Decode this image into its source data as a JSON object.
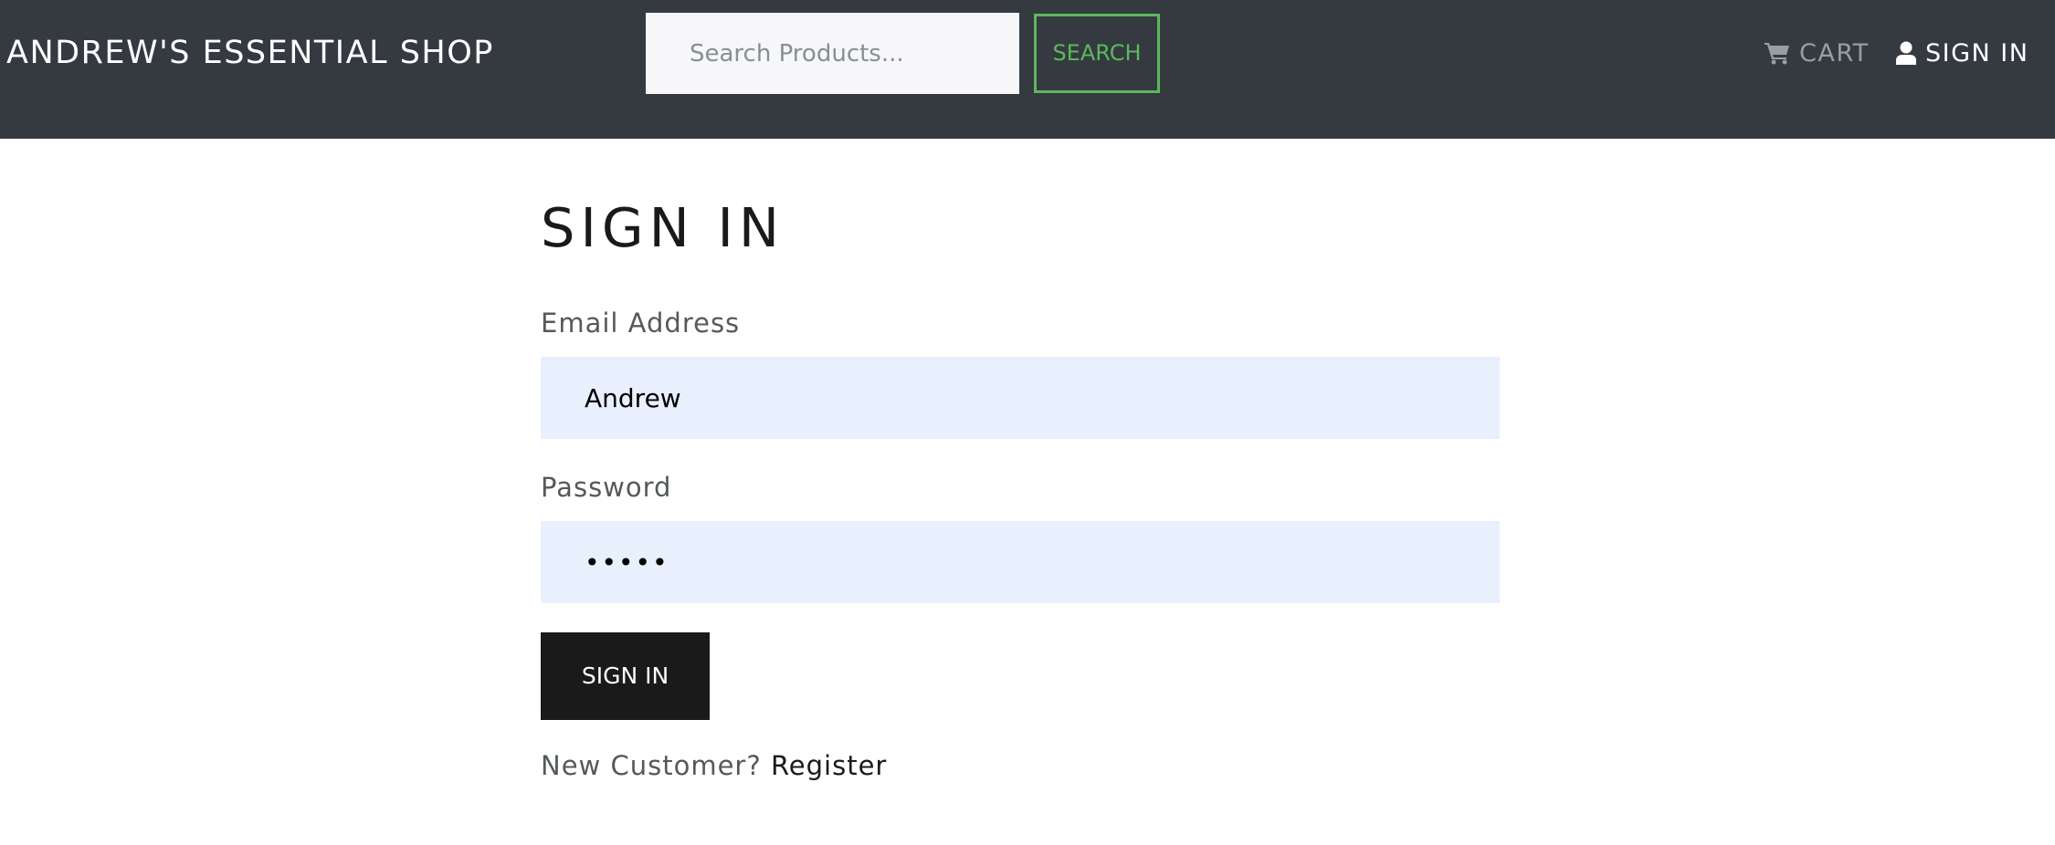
{
  "header": {
    "brand": "ANDREW'S ESSENTIAL SHOP",
    "search": {
      "placeholder": "Search Products...",
      "value": "",
      "button_label": "SEARCH"
    },
    "nav": {
      "cart_label": "CART",
      "cart_icon": "cart-icon",
      "signin_label": "SIGN IN",
      "signin_icon": "user-icon"
    }
  },
  "form": {
    "title": "SIGN IN",
    "email_label": "Email Address",
    "email_value": "Andrew",
    "password_label": "Password",
    "password_value": "•••••",
    "submit_label": "SIGN IN",
    "new_customer_text": "New Customer?",
    "register_link": "Register"
  },
  "colors": {
    "navbar_bg": "#343a40",
    "search_accent": "#5cb85c",
    "input_bg": "#e8f0fe",
    "button_bg": "#1a1a1a"
  }
}
